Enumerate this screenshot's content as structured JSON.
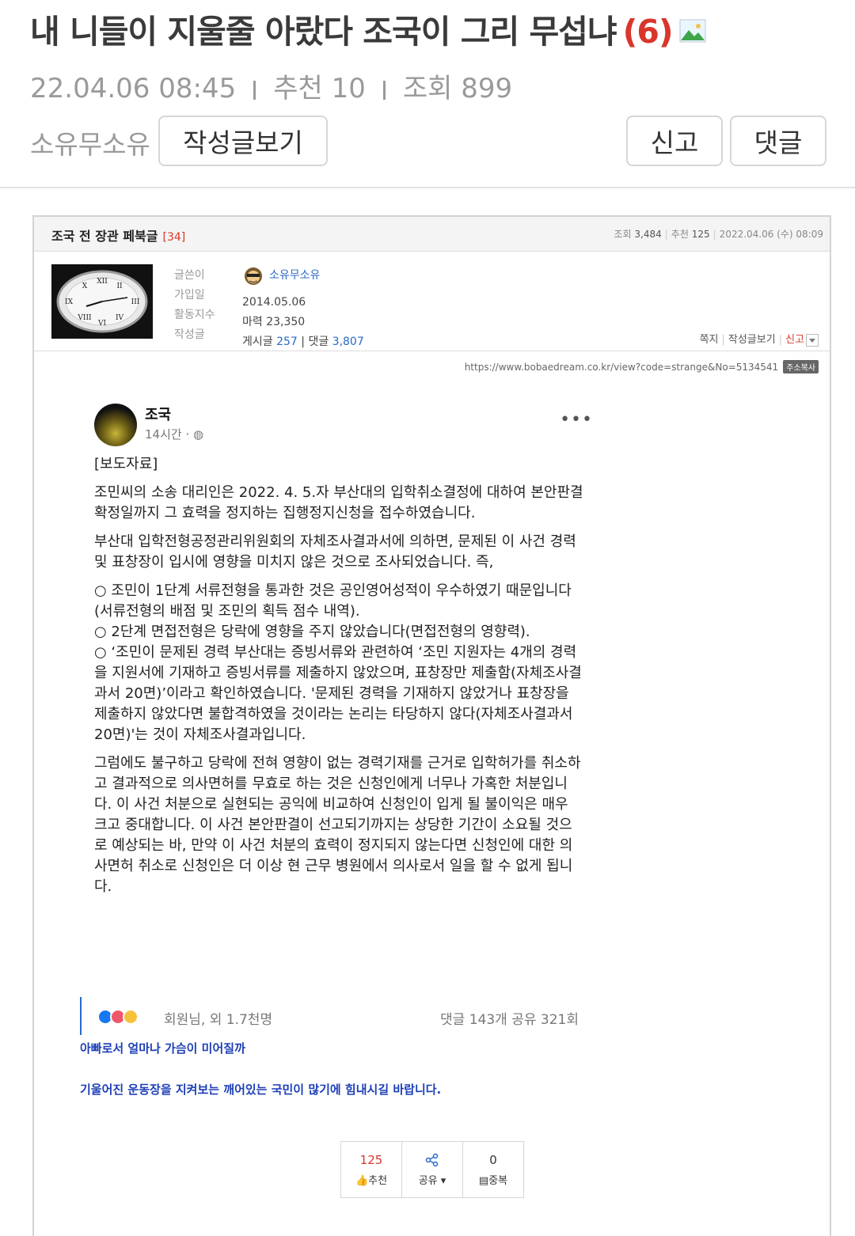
{
  "post": {
    "title": "내 니들이 지울줄 아랐다 조국이 그리 무섭냐",
    "comment_count": "(6)",
    "date": "22.04.06  08:45",
    "recommend": "추천 10",
    "views": "조회 899",
    "author": "소유무소유",
    "btn_posts": "작성글보기",
    "btn_report": "신고",
    "btn_comment": "댓글"
  },
  "embed": {
    "header": {
      "title": "조국 전 장관 페북글",
      "comments": "[34]",
      "views_label": "조회",
      "views": "3,484",
      "rec_label": "추천",
      "rec": "125",
      "date": "2022.04.06 (수) 08:09"
    },
    "user": {
      "label_writer": "글쓴이",
      "label_joined": "가입일",
      "label_activity": "활동지수",
      "label_posts": "작성글",
      "nick": "소유무소유",
      "joined": "2014.05.06",
      "activity": "마력 23,350",
      "posts_label": "게시글",
      "posts": "257",
      "comments_label": "댓글",
      "comments": "3,807"
    },
    "actions": {
      "message": "쪽지",
      "posts": "작성글보기",
      "report": "신고"
    },
    "url": "https://www.bobaedream.co.kr/view?code=strange&No=5134541",
    "copy": "주소복사",
    "fb": {
      "name": "조국",
      "time": "14시간 · ◍",
      "p1": "[보도자료]",
      "p2": "조민씨의 소송 대리인은 2022. 4. 5.자 부산대의 입학취소결정에 대하여 본안판결확정일까지 그 효력을 정지하는 집행정지신청을 접수하였습니다.",
      "p3": "부산대 입학전형공정관리위원회의 자체조사결과서에 의하면, 문제된 이 사건 경력 및 표창장이 입시에 영향을 미치지 않은 것으로 조사되었습니다. 즉,",
      "p4": "○ 조민이 1단계 서류전형을 통과한 것은 공인영어성적이 우수하였기 때문입니다(서류전형의 배점 및 조민의 획득 점수 내역).",
      "p5": "○ 2단계 면접전형은 당락에 영향을 주지 않았습니다(면접전형의 영향력).",
      "p6": "○ ‘조민이 문제된 경력 부산대는 증빙서류와 관련하여 ‘조민 지원자는 4개의 경력을 지원서에 기재하고 증빙서류를 제출하지 않았으며, 표창장만 제출함(자체조사결과서 20면)’이라고 확인하였습니다. '문제된 경력을 기재하지 않았거나 표창장을 제출하지 않았다면 불합격하였을 것이라는 논리는 타당하지 않다(자체조사결과서 20면)'는 것이 자체조사결과입니다.",
      "p7": "그럼에도 불구하고 당락에 전혀 영향이 없는 경력기재를 근거로 입학허가를 취소하고 결과적으로 의사면허를 무효로 하는 것은 신청인에게 너무나 가혹한 처분입니다. 이 사건 처분으로 실현되는 공익에 비교하여 신청인이 입게 될 불이익은 매우 크고 중대합니다. 이 사건 본안판결이 선고되기까지는 상당한 기간이 소요될 것으로 예상되는 바, 만약 이 사건 처분의 효력이 정지되지 않는다면 신청인에 대한 의사면허 취소로 신청인은 더 이상 현 근무 병원에서 의사로서 일을 할 수 없게 됩니다.",
      "reactions": "회원님, 외 1.7천명",
      "counts": "댓글 143개  공유 321회"
    },
    "comment1": "아빠로서 얼마나 가슴이 미어질까",
    "comment2": "기울어진 운동장을 지켜보는 깨어있는 국민이 많기에 힘내시길 바랍니다.",
    "bar": {
      "rec_count": "125",
      "rec_label": "추천",
      "share_label": "공유",
      "dup_count": "0",
      "dup_label": "중복"
    }
  },
  "colors": {
    "accent_red": "#d9362b",
    "link_blue": "#1d3fb7",
    "user_blue": "#2a6ac7"
  }
}
